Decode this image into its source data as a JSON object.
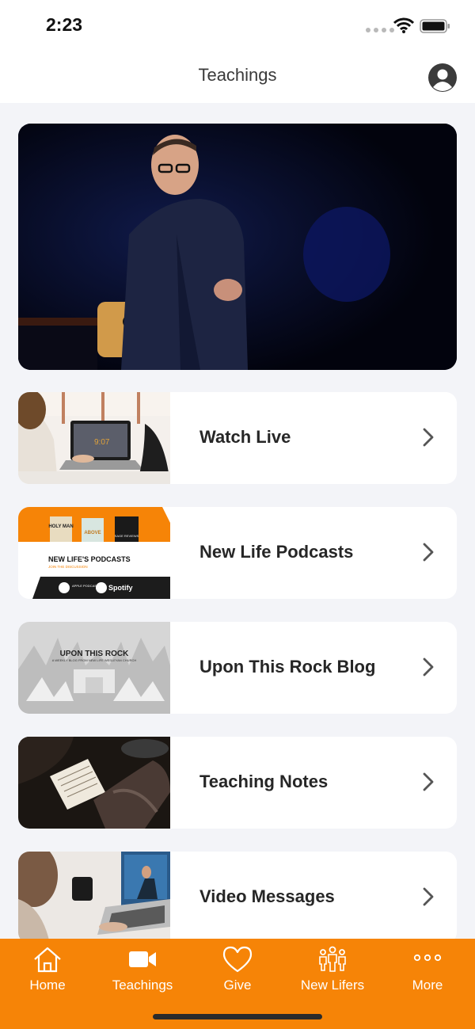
{
  "status_bar": {
    "time": "2:23"
  },
  "header": {
    "title": "Teachings"
  },
  "hero": {
    "alt": "Speaker on stage"
  },
  "menu": [
    {
      "label": "Watch Live",
      "icon": "chevron-right-icon"
    },
    {
      "label": "New Life Podcasts",
      "icon": "chevron-right-icon",
      "thumb": {
        "title": "NEW LIFE'S PODCASTS",
        "subtitle": "JOIN THE DISCUSSION",
        "badge1": "HOLY MAN",
        "badge2": "ABOVE",
        "badge3": "SAGE REVIEWS",
        "apple": "APPLE PODCASTS",
        "spotify": "Spotify"
      }
    },
    {
      "label": "Upon This Rock Blog",
      "icon": "chevron-right-icon",
      "thumb": {
        "title": "UPON THIS ROCK",
        "subtitle": "A WEEKLY BLOG FROM NEW LIFE WESLEYAN CHURCH"
      }
    },
    {
      "label": "Teaching Notes",
      "icon": "chevron-right-icon"
    },
    {
      "label": "Video Messages",
      "icon": "chevron-right-icon"
    }
  ],
  "tabs": [
    {
      "label": "Home",
      "icon": "home-icon"
    },
    {
      "label": "Teachings",
      "icon": "video-camera-icon"
    },
    {
      "label": "Give",
      "icon": "heart-icon"
    },
    {
      "label": "New Lifers",
      "icon": "people-icon"
    },
    {
      "label": "More",
      "icon": "more-dots-icon"
    }
  ],
  "colors": {
    "accent": "#f68407",
    "background": "#f3f4f8"
  }
}
